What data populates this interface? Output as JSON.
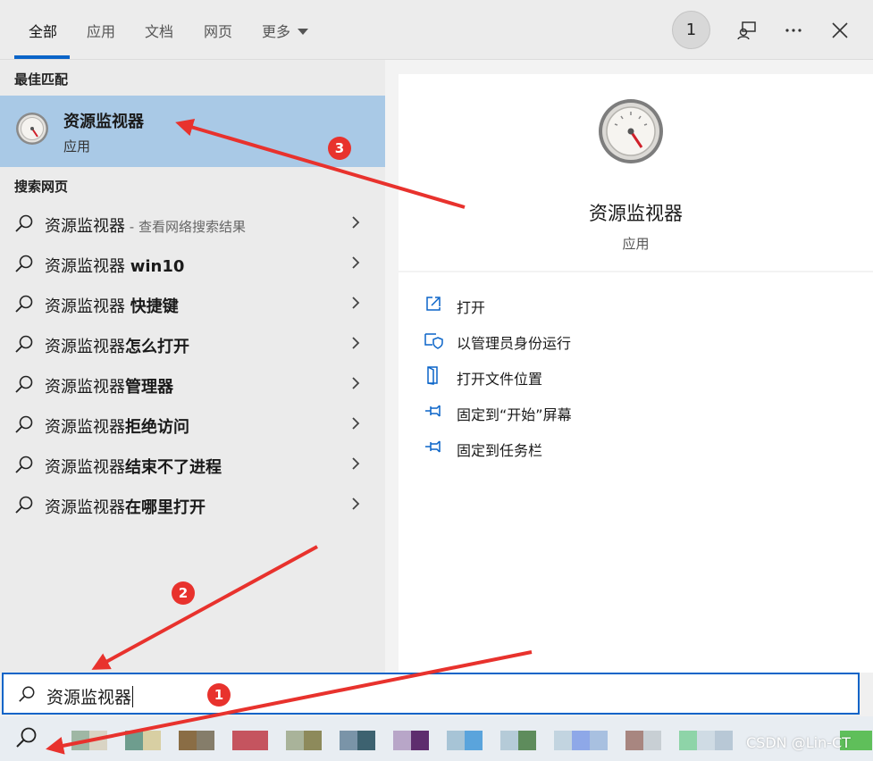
{
  "tabs": [
    {
      "label": "全部"
    },
    {
      "label": "应用"
    },
    {
      "label": "文档"
    },
    {
      "label": "网页"
    },
    {
      "label": "更多"
    }
  ],
  "header": {
    "badge_count": "1"
  },
  "best_match": {
    "section_label": "最佳匹配",
    "title": "资源监视器",
    "subtitle": "应用"
  },
  "web_search": {
    "section_label": "搜索网页",
    "items": [
      {
        "prefix": "资源监视器",
        "bold": "",
        "hint": " - 查看网络搜索结果"
      },
      {
        "prefix": "资源监视器 ",
        "bold": "win10",
        "hint": ""
      },
      {
        "prefix": "资源监视器 ",
        "bold": "快捷键",
        "hint": ""
      },
      {
        "prefix": "资源监视器",
        "bold": "怎么打开",
        "hint": ""
      },
      {
        "prefix": "资源监视器",
        "bold": "管理器",
        "hint": ""
      },
      {
        "prefix": "资源监视器",
        "bold": "拒绝访问",
        "hint": ""
      },
      {
        "prefix": "资源监视器",
        "bold": "结束不了进程",
        "hint": ""
      },
      {
        "prefix": "资源监视器",
        "bold": "在哪里打开",
        "hint": ""
      }
    ]
  },
  "preview": {
    "title": "资源监视器",
    "subtitle": "应用",
    "actions": [
      {
        "label": "打开",
        "icon": "open-window-icon"
      },
      {
        "label": "以管理员身份运行",
        "icon": "admin-shield-icon"
      },
      {
        "label": "打开文件位置",
        "icon": "file-location-icon"
      },
      {
        "label": "固定到“开始”屏幕",
        "icon": "pin-icon"
      },
      {
        "label": "固定到任务栏",
        "icon": "pin-icon"
      }
    ]
  },
  "search": {
    "query": "资源监视器"
  },
  "annotations": {
    "markers": [
      "1",
      "2",
      "3"
    ],
    "color": "#e8322d"
  },
  "watermark": "CSDN @Lin-CT",
  "colors": {
    "accent": "#0a64c8",
    "selected_bg": "#a9c9e6"
  }
}
